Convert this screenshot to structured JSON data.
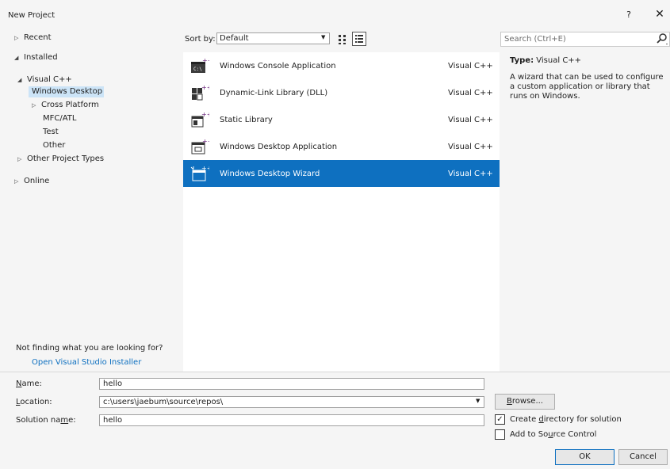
{
  "window": {
    "title": "New Project",
    "help": "?",
    "close": "✕"
  },
  "left_pane": {
    "recent": "Recent",
    "installed": "Installed",
    "visual_cpp": "Visual C++",
    "windows_desktop": "Windows Desktop",
    "cross_platform": "Cross Platform",
    "mfc_atl": "MFC/ATL",
    "test": "Test",
    "other": "Other",
    "other_project_types": "Other Project Types",
    "online": "Online",
    "not_finding": "Not finding what you are looking for?",
    "installer_link": "Open Visual Studio Installer"
  },
  "sort": {
    "label": "Sort by:",
    "value": "Default"
  },
  "templates": [
    {
      "name": "Windows Console Application",
      "lang": "Visual C++"
    },
    {
      "name": "Dynamic-Link Library (DLL)",
      "lang": "Visual C++"
    },
    {
      "name": "Static Library",
      "lang": "Visual C++"
    },
    {
      "name": "Windows Desktop Application",
      "lang": "Visual C++"
    },
    {
      "name": "Windows Desktop Wizard",
      "lang": "Visual C++"
    }
  ],
  "search": {
    "placeholder": "Search (Ctrl+E)"
  },
  "details": {
    "type_label": "Type:",
    "type_value": "Visual C++",
    "description": "A wizard that can be used to configure a custom application or library that runs on Windows."
  },
  "form": {
    "name_label_pre": "",
    "name_label_u": "N",
    "name_label_post": "ame:",
    "name_value": "hello",
    "location_label_pre": "",
    "location_label_u": "L",
    "location_label_post": "ocation:",
    "location_value": "c:\\users\\jaebum\\source\\repos\\",
    "solution_label_pre": "Solution na",
    "solution_label_u": "m",
    "solution_label_post": "e:",
    "solution_value": "hello",
    "browse_pre": "",
    "browse_u": "B",
    "browse_post": "rowse...",
    "create_dir_pre": "Create ",
    "create_dir_u": "d",
    "create_dir_post": "irectory for solution",
    "create_dir_check": "✓",
    "source_control_pre": "Add to So",
    "source_control_u": "u",
    "source_control_post": "rce Control",
    "ok": "OK",
    "cancel": "Cancel"
  },
  "colors": {
    "accent": "#0e70c0",
    "selection_light": "#cce4f7"
  }
}
